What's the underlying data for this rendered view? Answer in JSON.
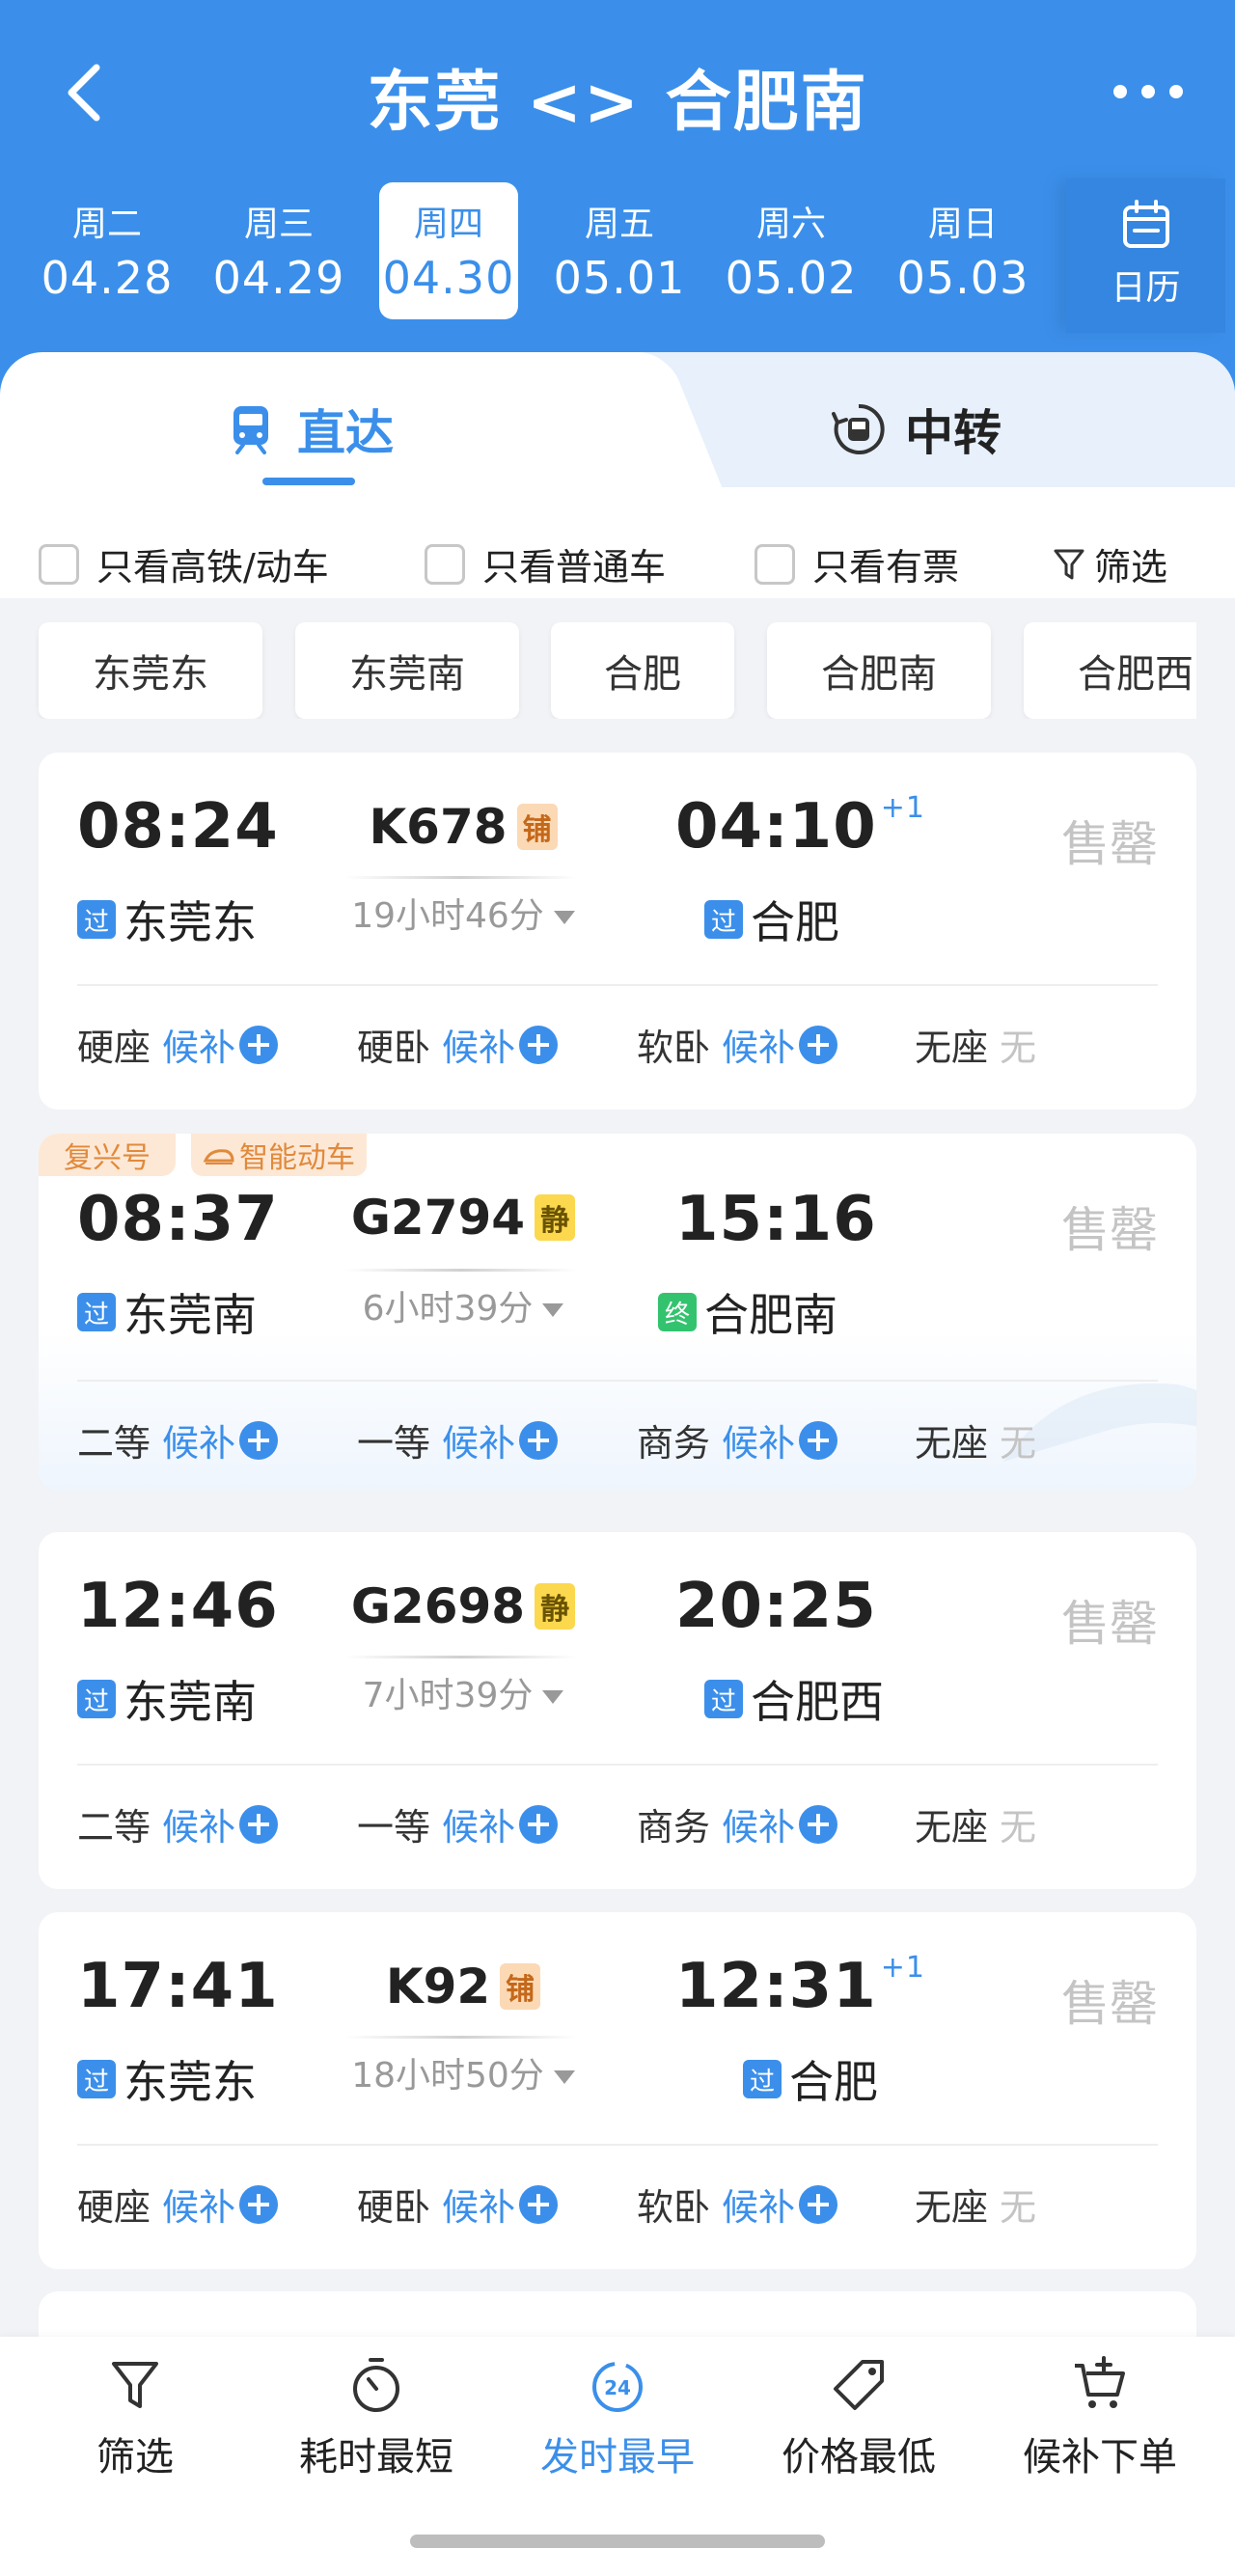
{
  "header": {
    "title": "东莞 <> 合肥南",
    "back_icon": "chevron-left-icon",
    "more_icon": "more-dots-icon",
    "calendar_label": "日历"
  },
  "dates": [
    {
      "weekday": "周二",
      "date": "04.28"
    },
    {
      "weekday": "周三",
      "date": "04.29"
    },
    {
      "weekday": "周四",
      "date": "04.30",
      "selected": true
    },
    {
      "weekday": "周五",
      "date": "05.01"
    },
    {
      "weekday": "周六",
      "date": "05.02"
    },
    {
      "weekday": "周日",
      "date": "05.03"
    }
  ],
  "tabs": {
    "direct": "直达",
    "transfer": "中转",
    "active": "direct"
  },
  "filters": {
    "high_speed_only": "只看高铁/动车",
    "regular_only": "只看普通车",
    "available_only": "只看有票",
    "filter_label": "筛选"
  },
  "stations": [
    "东莞东",
    "东莞南",
    "合肥",
    "合肥南",
    "合肥西"
  ],
  "trains": [
    {
      "dep_time": "08:24",
      "arr_time": "04:10",
      "plus_day": "+1",
      "train_no": "K678",
      "badge": "铺",
      "duration": "19小时46分",
      "from_mark": "过",
      "from": "东莞东",
      "to_mark": "过",
      "to": "合肥",
      "status": "售罄",
      "seats": [
        {
          "name": "硬座",
          "state": "候补"
        },
        {
          "name": "硬卧",
          "state": "候补"
        },
        {
          "name": "软卧",
          "state": "候补"
        },
        {
          "name": "无座",
          "state": "无"
        }
      ]
    },
    {
      "tags": [
        "复兴号",
        "智能动车"
      ],
      "dep_time": "08:37",
      "arr_time": "15:16",
      "plus_day": "",
      "train_no": "G2794",
      "badge": "静",
      "duration": "6小时39分",
      "from_mark": "过",
      "from": "东莞南",
      "to_mark": "终",
      "to": "合肥南",
      "status": "售罄",
      "seats": [
        {
          "name": "二等",
          "state": "候补"
        },
        {
          "name": "一等",
          "state": "候补"
        },
        {
          "name": "商务",
          "state": "候补"
        },
        {
          "name": "无座",
          "state": "无"
        }
      ]
    },
    {
      "dep_time": "12:46",
      "arr_time": "20:25",
      "plus_day": "",
      "train_no": "G2698",
      "badge": "静",
      "duration": "7小时39分",
      "from_mark": "过",
      "from": "东莞南",
      "to_mark": "过",
      "to": "合肥西",
      "status": "售罄",
      "seats": [
        {
          "name": "二等",
          "state": "候补"
        },
        {
          "name": "一等",
          "state": "候补"
        },
        {
          "name": "商务",
          "state": "候补"
        },
        {
          "name": "无座",
          "state": "无"
        }
      ]
    },
    {
      "dep_time": "17:41",
      "arr_time": "12:31",
      "plus_day": "+1",
      "train_no": "K92",
      "badge": "铺",
      "duration": "18小时50分",
      "from_mark": "过",
      "from": "东莞东",
      "to_mark": "过",
      "to": "合肥",
      "status": "售罄",
      "seats": [
        {
          "name": "硬座",
          "state": "候补"
        },
        {
          "name": "硬卧",
          "state": "候补"
        },
        {
          "name": "软卧",
          "state": "候补"
        },
        {
          "name": "无座",
          "state": "无"
        }
      ]
    }
  ],
  "bottom_bar": [
    {
      "label": "筛选",
      "icon": "filter-icon"
    },
    {
      "label": "耗时最短",
      "icon": "timer-icon"
    },
    {
      "label": "发时最早",
      "icon": "clock-24-icon",
      "active": true
    },
    {
      "label": "价格最低",
      "icon": "price-tag-icon"
    },
    {
      "label": "候补下单",
      "icon": "cart-plus-icon"
    }
  ],
  "colors": {
    "brand": "#3b8fea",
    "sold_out": "#c4c4c4",
    "tag_orange": "#e08a3c",
    "end_green": "#33c36f"
  }
}
